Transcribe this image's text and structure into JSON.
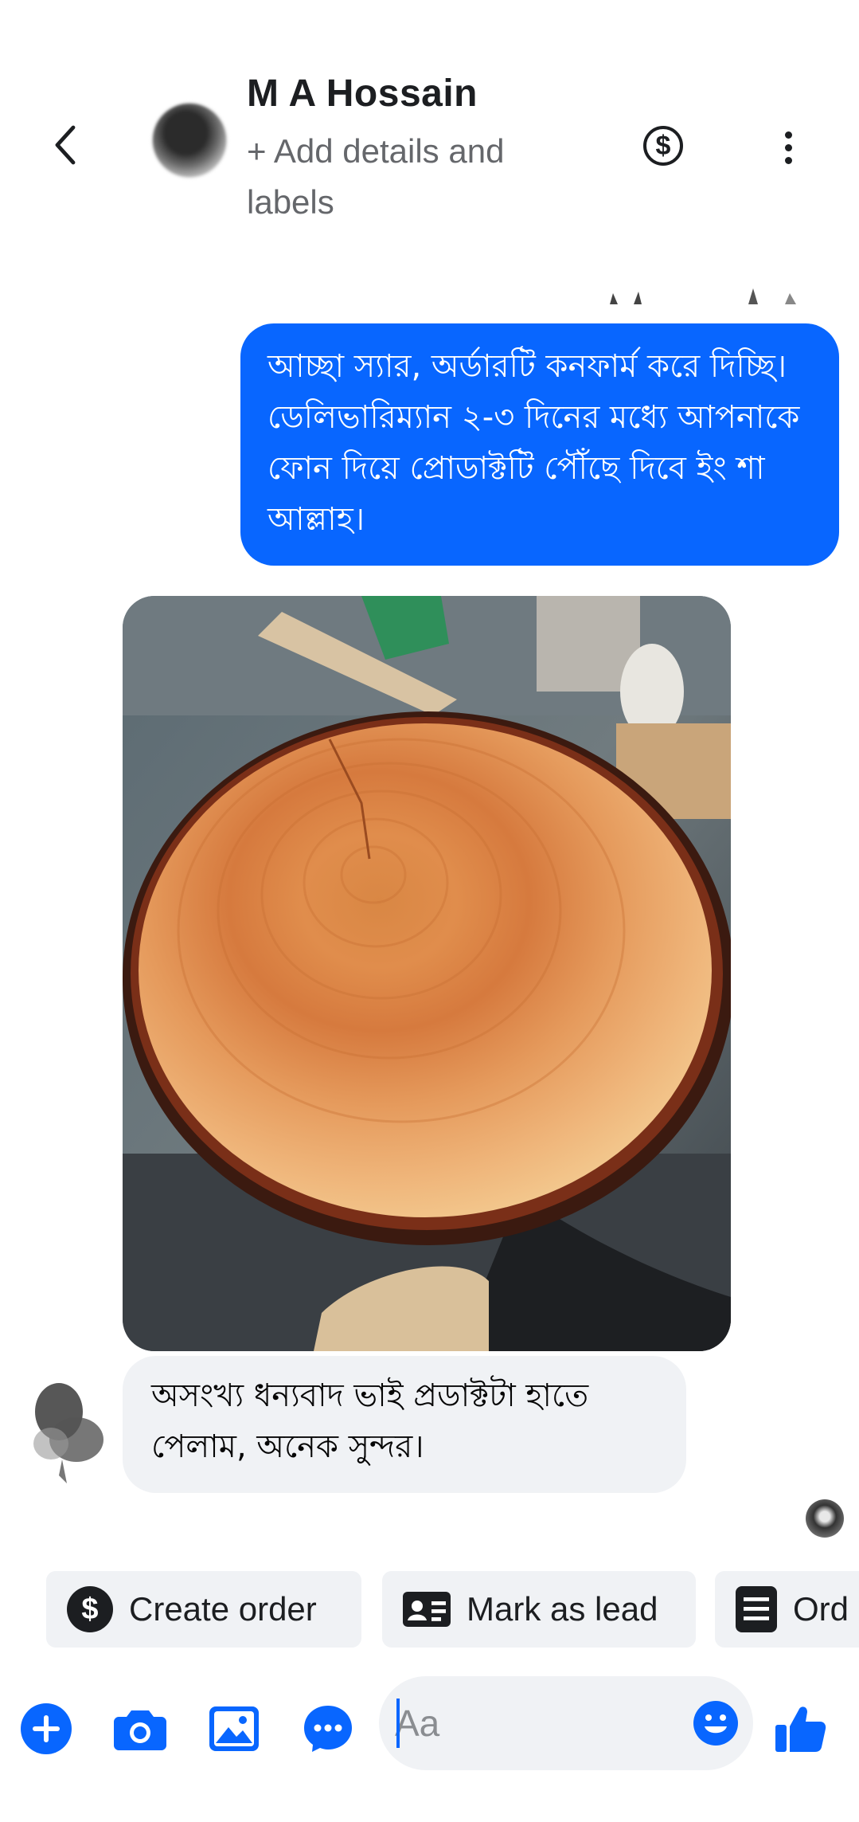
{
  "header": {
    "back_icon": "chevron-left-icon",
    "contact_name": "M A Hossain",
    "add_details": "+ Add details and labels",
    "payment_icon": "dollar-circle-icon",
    "more_icon": "more-vertical-icon"
  },
  "messages": [
    {
      "direction": "outgoing",
      "text": "আচ্ছা স্যার, অর্ডারটি কনফার্ম করে দিচ্ছি। ডেলিভারিম্যান ২-৩ দিনের মধ্যে আপনাকে ফোন দিয়ে প্রোডাক্টটি পৌঁছে দিবে ইং শা আল্লাহ।"
    },
    {
      "direction": "incoming",
      "type": "image",
      "content": "photo-wood-slice"
    },
    {
      "direction": "incoming",
      "text": "অসংখ্য ধন্যবাদ ভাই প্রডাক্টটা হাতে পেলাম, অনেক সুন্দর।"
    }
  ],
  "quick_actions": [
    {
      "icon": "dollar-circle-icon",
      "label": "Create order"
    },
    {
      "icon": "id-card-icon",
      "label": "Mark as lead"
    },
    {
      "icon": "list-document-icon",
      "label": "Ord"
    }
  ],
  "composer": {
    "placeholder": "Aa",
    "icons": [
      "plus-icon",
      "camera-icon",
      "image-icon",
      "messenger-chat-icon",
      "emoji-icon",
      "thumbs-up-icon"
    ]
  },
  "colors": {
    "accent": "#0866ff",
    "bubble_in": "#f0f2f5",
    "text_dark": "#1c1e21",
    "text_muted": "#65676b"
  }
}
